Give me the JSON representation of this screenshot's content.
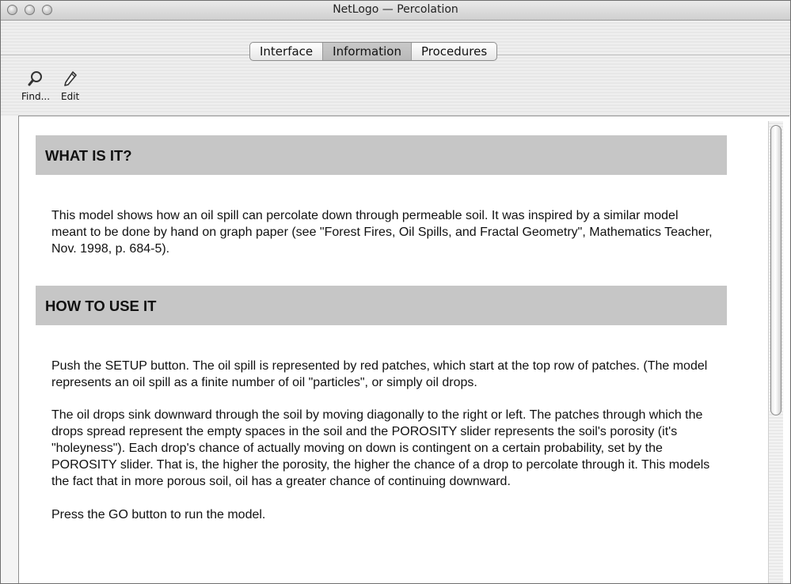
{
  "window": {
    "title": "NetLogo — Percolation"
  },
  "tabs": [
    {
      "label": "Interface",
      "active": false
    },
    {
      "label": "Information",
      "active": true
    },
    {
      "label": "Procedures",
      "active": false
    }
  ],
  "toolbar": {
    "find_label": "Find...",
    "find_icon": "magnifier-icon",
    "edit_label": "Edit",
    "edit_icon": "pencil-icon"
  },
  "info": {
    "sections": [
      {
        "heading": "WHAT IS IT?",
        "paragraphs": [
          "This model shows how an oil spill can percolate down through permeable soil. It was inspired by a similar model meant to be done by hand on graph paper (see \"Forest Fires, Oil Spills, and Fractal Geometry\", Mathematics Teacher, Nov. 1998, p. 684-5)."
        ]
      },
      {
        "heading": "HOW TO USE IT",
        "paragraphs": [
          "Push the SETUP button. The oil spill is represented by red patches, which start at the top row of patches. (The model represents an oil spill as a finite number of oil \"particles\", or simply oil drops.",
          "The oil drops sink downward through the soil by moving diagonally to the right or left. The patches through which the drops spread represent the empty spaces in the soil and the POROSITY slider represents the soil's porosity (it's \"holeyness\"). Each drop's chance of actually moving on down is contingent on a certain probability, set by the POROSITY slider. That is, the higher the porosity, the higher the chance of a drop to percolate through it. This models the fact that in more porous soil, oil has a greater chance of continuing downward.",
          "Press the GO button to run the model."
        ]
      }
    ]
  },
  "colors": {
    "heading_bg": "#c6c6c6",
    "active_tab": "#bdbdbd"
  }
}
